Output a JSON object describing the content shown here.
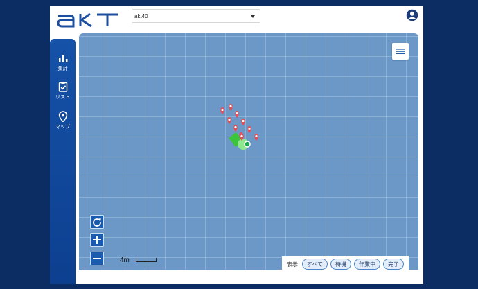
{
  "brand": {
    "logo_text": "akt",
    "color": "#1d4fa0"
  },
  "header": {
    "device_select": {
      "value": "akt40"
    },
    "account_icon": "account-circle-icon"
  },
  "sidebar": {
    "items": [
      {
        "label": "集計",
        "icon": "bar-chart-icon"
      },
      {
        "label": "リスト",
        "icon": "clipboard-check-icon"
      },
      {
        "label": "マップ",
        "icon": "map-pin-icon"
      }
    ]
  },
  "map": {
    "scale_label": "4m",
    "markers": {
      "red": 10,
      "green": 2
    },
    "controls": [
      "refresh-icon",
      "zoom-in-icon",
      "zoom-out-icon"
    ]
  },
  "filters": {
    "label": "表示",
    "buttons": [
      "すべて",
      "待機",
      "作業中",
      "完了"
    ]
  },
  "colors": {
    "background": "#0b2d63",
    "sidebar": "#1552a8",
    "map": "#6c98c8",
    "marker_red": "#e84a50",
    "marker_green": "#3cc43c"
  }
}
